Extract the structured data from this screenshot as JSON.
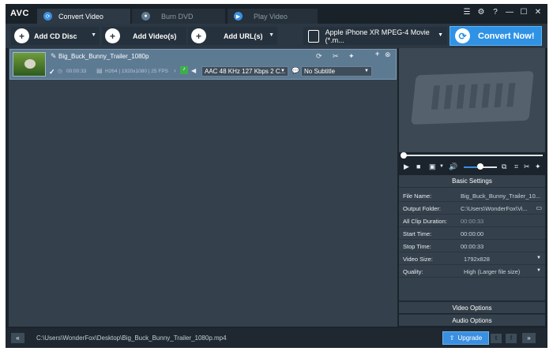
{
  "app": {
    "logo": "AVC"
  },
  "tabs": [
    {
      "label": "Convert Video",
      "icon": "refresh-icon"
    },
    {
      "label": "Burn DVD",
      "icon": "disc-icon"
    },
    {
      "label": "Play Video",
      "icon": "play-icon"
    }
  ],
  "window_controls": {
    "list": "☰",
    "settings": "⚙",
    "help": "?",
    "minimize": "—",
    "maximize": "☐",
    "close": "✕"
  },
  "toolbar": {
    "add_cd": "Add CD Disc",
    "add_video": "Add Video(s)",
    "add_url": "Add URL(s)",
    "profile": "Apple iPhone XR MPEG-4 Movie (*.m...",
    "convert": "Convert Now!"
  },
  "file": {
    "name": "Big_Buck_Bunny_Trailer_1080p",
    "duration": "00:00:33",
    "video_info": "H264 | 1920x1080 | 25 FPS",
    "audio": "AAC 48 KHz 127 Kbps 2 C...",
    "subtitle": "No Subtitle"
  },
  "settings": {
    "title": "Basic Settings",
    "rows": [
      {
        "label": "File Name:",
        "value": "Big_Buck_Bunny_Trailer_10..."
      },
      {
        "label": "Output Folder:",
        "value": "C:\\Users\\WonderFox\\Vi..."
      },
      {
        "label": "All Clip Duration:",
        "value": "00:00:33"
      },
      {
        "label": "Start Time:",
        "value": "00:00:00"
      },
      {
        "label": "Stop Time:",
        "value": "00:00:33"
      },
      {
        "label": "Video Size:",
        "value": "1792x828"
      },
      {
        "label": "Quality:",
        "value": "High (Larger file size)"
      }
    ],
    "video_options": "Video Options",
    "audio_options": "Audio Options"
  },
  "player": {
    "volume_level_percent": 45
  },
  "bottom": {
    "path": "C:\\Users\\WonderFox\\Desktop\\Big_Buck_Bunny_Trailer_1080p.mp4",
    "upgrade": "Upgrade"
  },
  "colors": {
    "accent": "#2f92e5",
    "panel": "#34404b",
    "selected_row": "#5d7a93"
  }
}
